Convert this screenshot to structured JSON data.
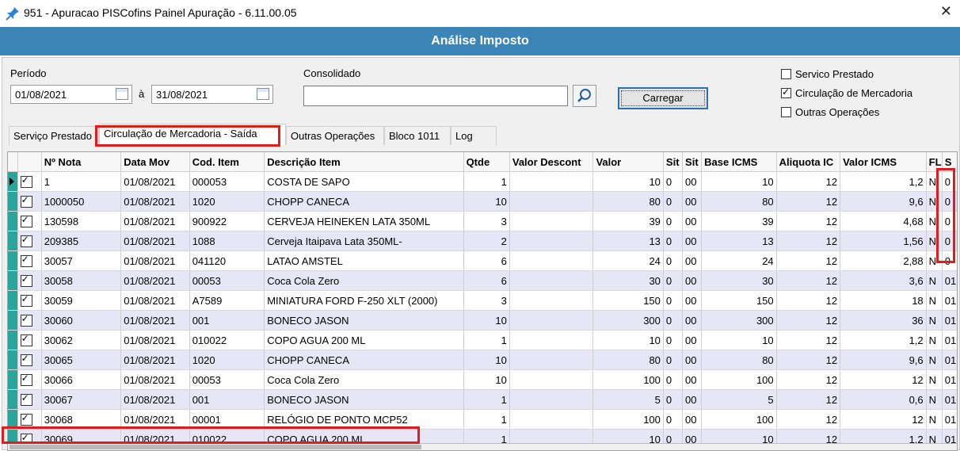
{
  "window": {
    "title": "951 - Apuracao PISCofins Painel Apuração - 6.11.00.05"
  },
  "banner": {
    "title": "Análise Imposto"
  },
  "filters": {
    "periodo_label": "Período",
    "date_from": "01/08/2021",
    "date_sep": "à",
    "date_to": "31/08/2021",
    "consolidado_label": "Consolidado",
    "consolidado_value": "",
    "load_button": "Carregar"
  },
  "options": [
    {
      "label": "Servico Prestado",
      "checked": false
    },
    {
      "label": "Circulação de Mercadoria",
      "checked": true
    },
    {
      "label": "Outras Operações",
      "checked": false
    }
  ],
  "tabs": [
    "Serviço Prestado",
    "Circulação de Mercadoria - Saída",
    "Outras Operações",
    "Bloco 1011",
    "Log"
  ],
  "active_tab": "Circulação de Mercadoria - Saída",
  "table": {
    "columns": [
      "Nº Nota",
      "Data Mov",
      "Cod. Item",
      "Descrição Item",
      "Qtde",
      "Valor Descont",
      "Valor",
      "Sit",
      "Sit",
      "Base ICMS",
      "Aliquota IC",
      "Valor ICMS",
      "FL",
      "S"
    ],
    "rows": [
      [
        "1",
        "01/08/2021",
        "000053",
        "COSTA DE SAPO",
        "1",
        "",
        "10",
        "0",
        "00",
        "10",
        "12",
        "1,2",
        "N",
        "0"
      ],
      [
        "1000050",
        "01/08/2021",
        "1020",
        "CHOPP CANECA",
        "10",
        "",
        "80",
        "0",
        "00",
        "80",
        "12",
        "9,6",
        "N",
        "0"
      ],
      [
        "130598",
        "01/08/2021",
        "900922",
        "CERVEJA HEINEKEN LATA 350ML",
        "3",
        "",
        "39",
        "0",
        "00",
        "39",
        "12",
        "4,68",
        "N",
        "0"
      ],
      [
        "209385",
        "01/08/2021",
        "1088",
        "Cerveja Itaipava Lata 350ML-",
        "2",
        "",
        "13",
        "0",
        "00",
        "13",
        "12",
        "1,56",
        "N",
        "0"
      ],
      [
        "30057",
        "01/08/2021",
        "041120",
        "LATAO AMSTEL",
        "6",
        "",
        "24",
        "0",
        "00",
        "24",
        "12",
        "2,88",
        "N",
        "0"
      ],
      [
        "30058",
        "01/08/2021",
        "00053",
        "Coca Cola Zero",
        "6",
        "",
        "30",
        "0",
        "00",
        "30",
        "12",
        "3,6",
        "N",
        "01"
      ],
      [
        "30059",
        "01/08/2021",
        "A7589",
        "MINIATURA FORD F-250 XLT (2000)",
        "3",
        "",
        "150",
        "0",
        "00",
        "150",
        "12",
        "18",
        "N",
        "01"
      ],
      [
        "30060",
        "01/08/2021",
        "001",
        "BONECO JASON",
        "10",
        "",
        "300",
        "0",
        "00",
        "300",
        "12",
        "36",
        "N",
        "01"
      ],
      [
        "30062",
        "01/08/2021",
        "010022",
        "COPO AGUA 200 ML",
        "1",
        "",
        "10",
        "0",
        "00",
        "10",
        "12",
        "1,2",
        "N",
        "01"
      ],
      [
        "30065",
        "01/08/2021",
        "1020",
        "CHOPP CANECA",
        "10",
        "",
        "80",
        "0",
        "00",
        "80",
        "12",
        "9,6",
        "N",
        "01"
      ],
      [
        "30066",
        "01/08/2021",
        "00053",
        "Coca Cola Zero",
        "10",
        "",
        "100",
        "0",
        "00",
        "100",
        "12",
        "12",
        "N",
        "01"
      ],
      [
        "30067",
        "01/08/2021",
        "001",
        "BONECO JASON",
        "1",
        "",
        "5",
        "0",
        "00",
        "5",
        "12",
        "0,6",
        "N",
        "01"
      ],
      [
        "30068",
        "01/08/2021",
        "00001",
        "RELÓGIO DE PONTO MCP52",
        "1",
        "",
        "100",
        "0",
        "00",
        "100",
        "12",
        "12",
        "N",
        "01"
      ],
      [
        "30069",
        "01/08/2021",
        "010022",
        "COPO AGUA 200 ML",
        "1",
        "",
        "10",
        "0",
        "00",
        "10",
        "12",
        "1,2",
        "N",
        "01"
      ]
    ]
  }
}
